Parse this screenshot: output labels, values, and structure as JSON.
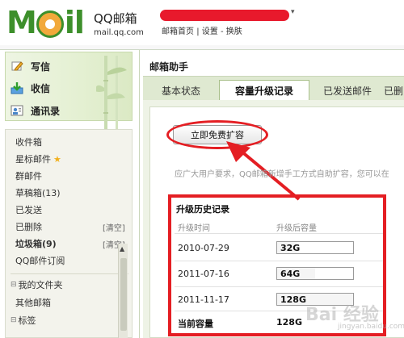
{
  "header": {
    "logo_text": "MOil",
    "brand_name": "QQ邮箱",
    "brand_url": "mail.qq.com",
    "links": [
      "邮箱首页",
      "设置",
      "换肤"
    ],
    "link_separator": "|",
    "account_caret": "▾"
  },
  "sidebar": {
    "actions": [
      {
        "label": "写信",
        "icon": "pencil-icon"
      },
      {
        "label": "收信",
        "icon": "inbox-download-icon"
      },
      {
        "label": "通讯录",
        "icon": "contacts-icon"
      }
    ],
    "folders": [
      {
        "label": "收件箱"
      },
      {
        "label": "星标邮件",
        "star": "★"
      },
      {
        "label": "群邮件"
      },
      {
        "label": "草稿箱(13)"
      },
      {
        "label": "已发送"
      },
      {
        "label": "已删除",
        "clear": "[清空]"
      },
      {
        "label": "垃圾箱(9)",
        "clear": "[清空]",
        "bold": true
      },
      {
        "label": "QQ邮件订阅"
      }
    ],
    "tree": [
      {
        "toggle": "⊟",
        "label": "我的文件夹"
      },
      {
        "label": "其他邮箱"
      },
      {
        "toggle": "⊟",
        "label": "标签"
      }
    ]
  },
  "main": {
    "title": "邮箱助手",
    "tabs": [
      {
        "label": "基本状态"
      },
      {
        "label": "容量升级记录",
        "active": true
      },
      {
        "label": "已发送邮件"
      },
      {
        "label": "已删"
      }
    ],
    "expand_button": "立即免费扩容",
    "description": "应广大用户要求，QQ邮箱新增手工方式自助扩容，您可以在",
    "history": {
      "title": "升级历史记录",
      "col_time": "升级时间",
      "col_capacity": "升级后容量",
      "rows": [
        {
          "date": "2010-07-29",
          "capacity": "32G",
          "fill": 0.25
        },
        {
          "date": "2011-07-16",
          "capacity": "64G",
          "fill": 0.5
        },
        {
          "date": "2011-11-17",
          "capacity": "128G",
          "fill": 1.0
        }
      ],
      "current_label": "当前容量",
      "current_value": "128G"
    }
  },
  "watermark": {
    "text": "Bai 经验",
    "sub": "jingyan.baidu.com"
  },
  "colors": {
    "brand_green": "#3d8f2b",
    "annotation_red": "#e41e23",
    "tab_bg": "#dfe9d1"
  }
}
